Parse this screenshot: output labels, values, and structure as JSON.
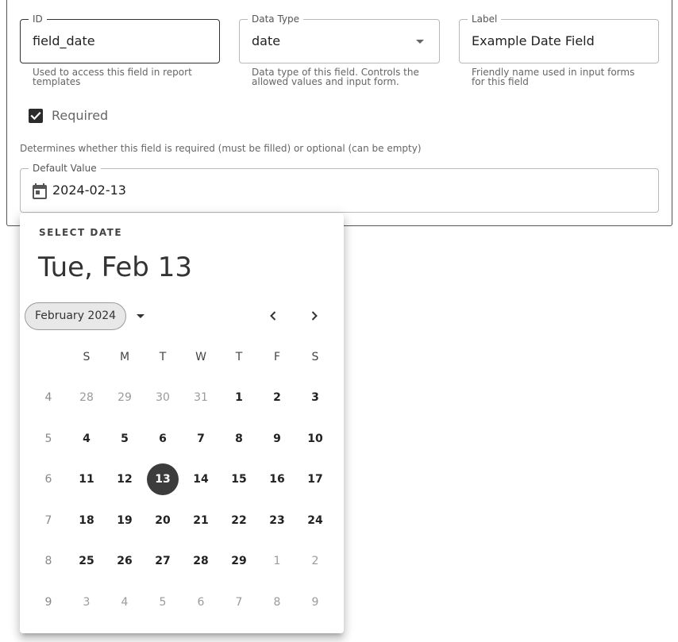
{
  "form": {
    "id_field": {
      "legend": "ID",
      "value": "field_date",
      "helper": "Used to access this field in report templates"
    },
    "data_type_field": {
      "legend": "Data Type",
      "value": "date",
      "helper": "Data type of this field. Controls the allowed values and input form."
    },
    "label_field": {
      "legend": "Label",
      "value": "Example Date Field",
      "helper": "Friendly name used in input forms for this field"
    },
    "required": {
      "label": "Required",
      "checked": true,
      "helper": "Determines whether this field is required (must be filled) or optional (can be empty)"
    },
    "default_value": {
      "legend": "Default Value",
      "value": "2024-02-13"
    }
  },
  "date_picker": {
    "overline": "SELECT DATE",
    "headline": "Tue, Feb 13",
    "month_label": "February 2024",
    "weekdays": [
      "S",
      "M",
      "T",
      "W",
      "T",
      "F",
      "S"
    ],
    "selected_day": 13,
    "weeks": [
      {
        "week": "4",
        "days": [
          {
            "d": "28",
            "m": true
          },
          {
            "d": "29",
            "m": true
          },
          {
            "d": "30",
            "m": true
          },
          {
            "d": "31",
            "m": true
          },
          {
            "d": "1"
          },
          {
            "d": "2"
          },
          {
            "d": "3"
          }
        ]
      },
      {
        "week": "5",
        "days": [
          {
            "d": "4"
          },
          {
            "d": "5"
          },
          {
            "d": "6"
          },
          {
            "d": "7"
          },
          {
            "d": "8"
          },
          {
            "d": "9"
          },
          {
            "d": "10"
          }
        ]
      },
      {
        "week": "6",
        "days": [
          {
            "d": "11"
          },
          {
            "d": "12"
          },
          {
            "d": "13",
            "s": true
          },
          {
            "d": "14"
          },
          {
            "d": "15"
          },
          {
            "d": "16"
          },
          {
            "d": "17"
          }
        ]
      },
      {
        "week": "7",
        "days": [
          {
            "d": "18"
          },
          {
            "d": "19"
          },
          {
            "d": "20"
          },
          {
            "d": "21"
          },
          {
            "d": "22"
          },
          {
            "d": "23"
          },
          {
            "d": "24"
          }
        ]
      },
      {
        "week": "8",
        "days": [
          {
            "d": "25"
          },
          {
            "d": "26"
          },
          {
            "d": "27"
          },
          {
            "d": "28"
          },
          {
            "d": "29"
          },
          {
            "d": "1",
            "m": true
          },
          {
            "d": "2",
            "m": true
          }
        ]
      },
      {
        "week": "9",
        "days": [
          {
            "d": "3",
            "m": true
          },
          {
            "d": "4",
            "m": true
          },
          {
            "d": "5",
            "m": true
          },
          {
            "d": "6",
            "m": true
          },
          {
            "d": "7",
            "m": true
          },
          {
            "d": "8",
            "m": true
          },
          {
            "d": "9",
            "m": true
          }
        ]
      }
    ]
  },
  "colors": {
    "selected_day_bg": "#3c3c3c",
    "checkbox_bg": "#2b2b2b",
    "muted_text": "#9a9a9a"
  },
  "icons": {
    "calendar": "calendar-icon",
    "dropdown": "chevron-down-icon",
    "prev": "chevron-left-icon",
    "next": "chevron-right-icon",
    "check": "check-icon"
  }
}
